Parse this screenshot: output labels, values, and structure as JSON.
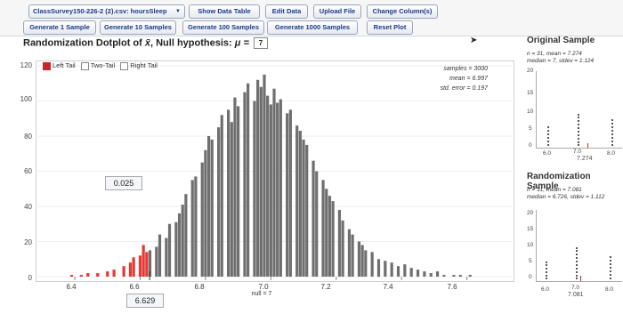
{
  "toolbar": {
    "dataset_select": "ClassSurvey150-226-2 (2).csv: hoursSleep",
    "show_data_table": "Show Data Table",
    "edit_data": "Edit Data",
    "upload_file": "Upload File",
    "change_columns": "Change Column(s)",
    "gen1": "Generate 1 Sample",
    "gen10": "Generate 10 Samples",
    "gen100": "Generate 100 Samples",
    "gen1000": "Generate 1000 Samples",
    "reset_plot": "Reset Plot"
  },
  "main": {
    "title_prefix": "Randomization Dotplot of",
    "title_x": "x̄",
    "title_suffix": ", Null hypothesis:",
    "mu": "μ =",
    "null_value": "7",
    "legend": {
      "left_tail": "Left Tail",
      "two_tail": "Two-Tail",
      "right_tail": "Right Tail"
    },
    "stats": {
      "samples": "samples = 3000",
      "mean": "mean = 6.997",
      "std_error": "std. error = 0.197"
    },
    "p_value": "0.025",
    "observed_xbar": "6.629",
    "null_label": "null = 7"
  },
  "chart_data": {
    "type": "bar",
    "yticks": [
      0,
      20,
      40,
      60,
      80,
      100,
      120
    ],
    "xticks": [
      6.4,
      6.6,
      6.8,
      7.0,
      7.2,
      7.4,
      7.6
    ],
    "xtick_labels": [
      "6.4",
      "6.6",
      "6.8",
      "7.0",
      "7.2",
      "7.4",
      "7.6"
    ],
    "xlim": [
      6.28,
      7.74
    ],
    "ylim": [
      0,
      120
    ],
    "x": [
      6.39,
      6.42,
      6.44,
      6.47,
      6.5,
      6.52,
      6.55,
      6.57,
      6.58,
      6.6,
      6.61,
      6.62,
      6.63,
      6.65,
      6.66,
      6.68,
      6.69,
      6.71,
      6.72,
      6.73,
      6.74,
      6.76,
      6.77,
      6.79,
      6.8,
      6.81,
      6.82,
      6.84,
      6.85,
      6.87,
      6.88,
      6.89,
      6.9,
      6.92,
      6.93,
      6.95,
      6.96,
      6.97,
      6.98,
      6.99,
      7.0,
      7.01,
      7.02,
      7.03,
      7.05,
      7.06,
      7.08,
      7.09,
      7.1,
      7.11,
      7.13,
      7.14,
      7.16,
      7.17,
      7.18,
      7.19,
      7.21,
      7.22,
      7.24,
      7.25,
      7.27,
      7.28,
      7.29,
      7.31,
      7.33,
      7.35,
      7.37,
      7.39,
      7.41,
      7.43,
      7.45,
      7.47,
      7.49,
      7.51,
      7.53,
      7.56,
      7.58,
      7.61
    ],
    "values": [
      1,
      1,
      2,
      2,
      3,
      4,
      6,
      8,
      11,
      12,
      18,
      14,
      15,
      17,
      24,
      22,
      30,
      31,
      36,
      41,
      47,
      55,
      57,
      65,
      72,
      80,
      78,
      85,
      92,
      95,
      88,
      102,
      97,
      105,
      110,
      100,
      112,
      108,
      115,
      103,
      98,
      107,
      99,
      101,
      93,
      95,
      86,
      83,
      78,
      75,
      66,
      60,
      55,
      50,
      46,
      43,
      38,
      32,
      27,
      24,
      20,
      18,
      15,
      14,
      10,
      9,
      8,
      6,
      7,
      5,
      4,
      3,
      2,
      3,
      1,
      1,
      1,
      1
    ],
    "highlight": {
      "color": "#e53935",
      "rule": "x <= 6.629"
    },
    "bar_color": "#6f6f6f"
  },
  "sidebar": {
    "original": {
      "title": "Original Sample",
      "line1": "n = 31, mean = 7.274",
      "line2": "median = 7, stdev = 1.124",
      "yticks": [
        "20",
        "15",
        "10",
        "5",
        "0"
      ],
      "xticks": [
        "6.0",
        "7.0",
        "8.0"
      ],
      "mean_label": "7.274"
    },
    "randomization": {
      "title": "Randomization Sample",
      "line1": "n = 31, mean = 7.081",
      "line2": "median = 6.726, stdev = 1.112",
      "yticks": [
        "20",
        "15",
        "10",
        "5",
        "0"
      ],
      "xticks": [
        "6.0",
        "7.0",
        "8.0"
      ],
      "mean_label": "7.081"
    }
  }
}
